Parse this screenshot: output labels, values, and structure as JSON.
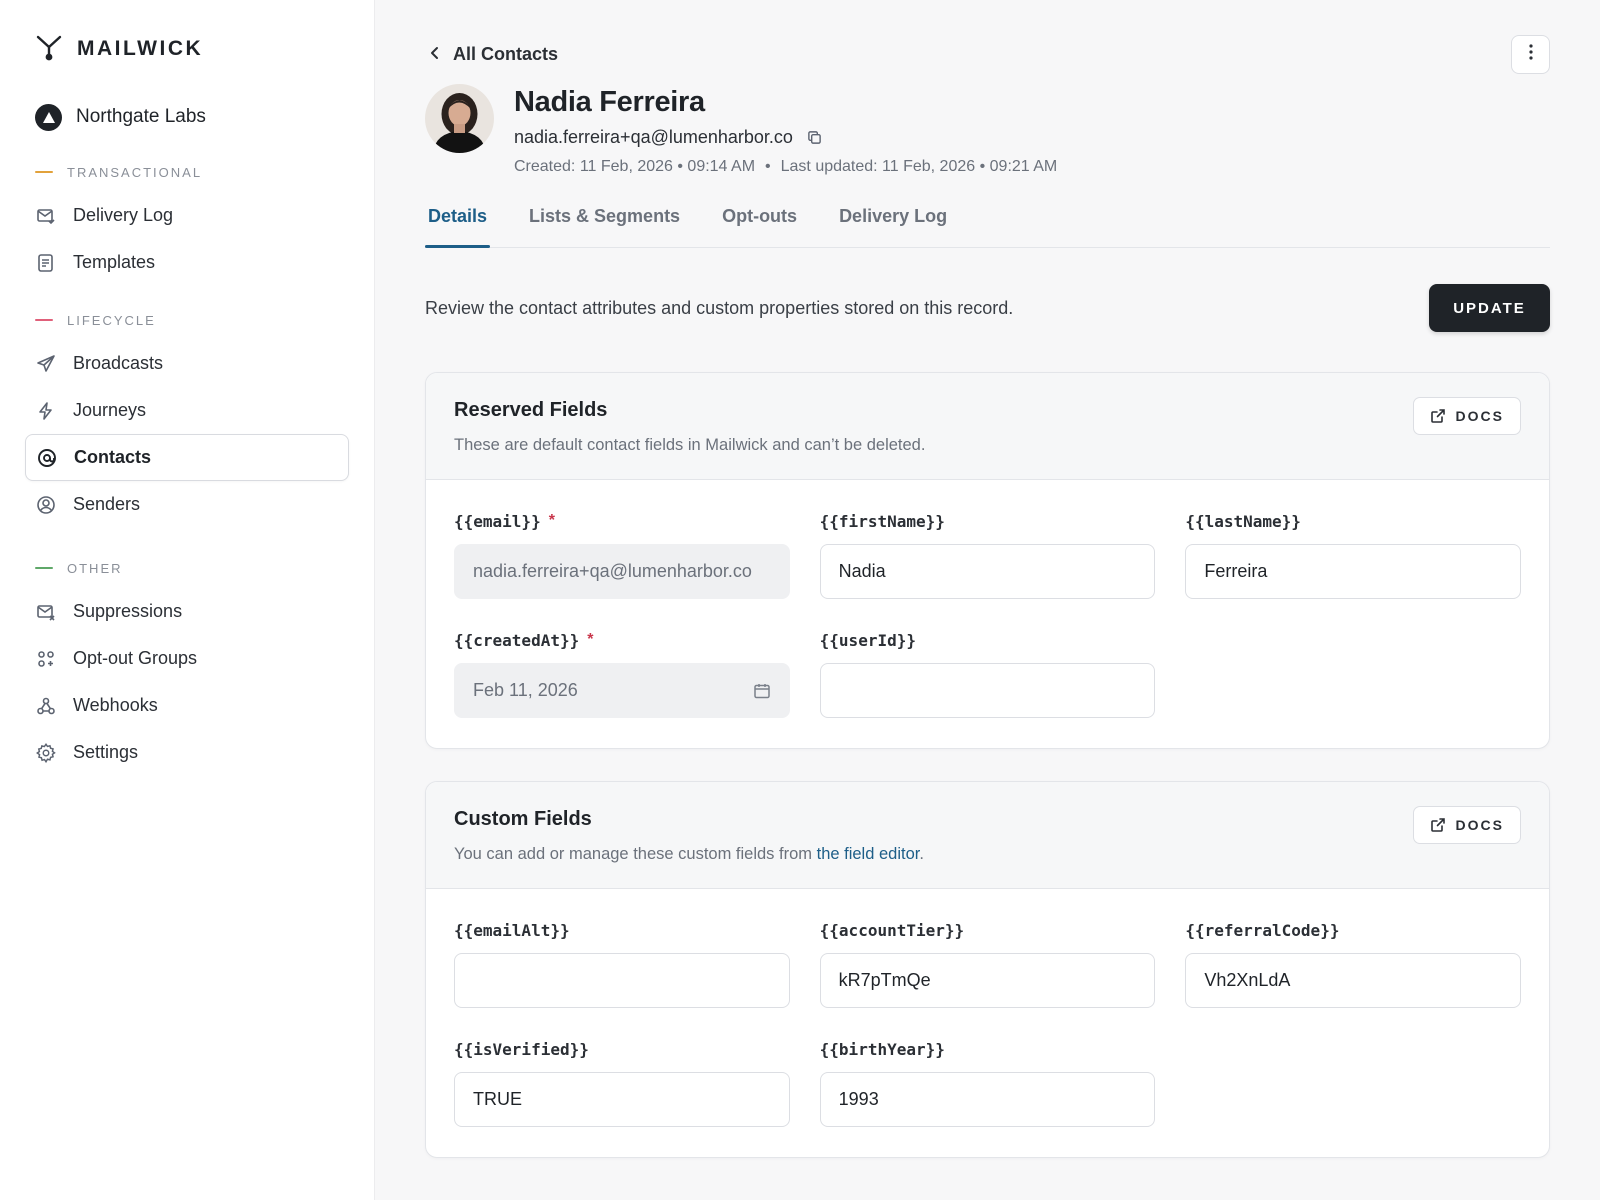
{
  "brand": {
    "name": "MAILWICK"
  },
  "org": {
    "name": "Northgate Labs"
  },
  "sidebar": {
    "sections": [
      {
        "label": "TRANSACTIONAL",
        "color": "#e2a23b",
        "items": [
          {
            "label": "Delivery Log",
            "icon": "mail-log-icon"
          },
          {
            "label": "Templates",
            "icon": "template-icon"
          }
        ]
      },
      {
        "label": "LIFECYCLE",
        "color": "#e0607a",
        "items": [
          {
            "label": "Broadcasts",
            "icon": "send-icon"
          },
          {
            "label": "Journeys",
            "icon": "bolt-icon"
          },
          {
            "label": "Contacts",
            "icon": "at-icon",
            "active": true
          },
          {
            "label": "Senders",
            "icon": "user-circle-icon"
          }
        ]
      },
      {
        "label": "OTHER",
        "color": "#5fa869",
        "items": [
          {
            "label": "Suppressions",
            "icon": "mail-block-icon"
          },
          {
            "label": "Opt-out Groups",
            "icon": "groups-icon"
          },
          {
            "label": "Webhooks",
            "icon": "webhook-icon"
          },
          {
            "label": "Settings",
            "icon": "gear-icon"
          }
        ]
      }
    ]
  },
  "header": {
    "back_label": "All Contacts"
  },
  "contact": {
    "name": "Nadia Ferreira",
    "email": "nadia.ferreira+qa@lumenharbor.co",
    "created": "Created: 11 Feb, 2026 • 09:14 AM",
    "sep": "•",
    "updated": "Last updated: 11 Feb, 2026 • 09:21 AM"
  },
  "tabs": [
    {
      "label": "Details",
      "active": true
    },
    {
      "label": "Lists & Segments"
    },
    {
      "label": "Opt-outs"
    },
    {
      "label": "Delivery Log"
    }
  ],
  "intro": {
    "text": "Review the contact attributes and custom properties stored on this record.",
    "update_label": "UPDATE"
  },
  "reserved": {
    "title": "Reserved Fields",
    "subtitle": "These are default contact fields in Mailwick and can’t be deleted.",
    "docs_label": "DOCS",
    "fields": [
      {
        "label": "{{email}}",
        "required": true,
        "value": "nadia.ferreira+qa@lumenharbor.co",
        "disabled": true
      },
      {
        "label": "{{firstName}}",
        "value": "Nadia"
      },
      {
        "label": "{{lastName}}",
        "value": "Ferreira"
      },
      {
        "label": "{{createdAt}}",
        "required": true,
        "value": "Feb 11, 2026",
        "disabled": true,
        "calendar": true
      },
      {
        "label": "{{userId}}",
        "value": ""
      }
    ]
  },
  "custom": {
    "title": "Custom Fields",
    "subtitle_prefix": "You can add or manage these custom fields from ",
    "subtitle_link": "the field editor",
    "subtitle_suffix": ".",
    "docs_label": "DOCS",
    "fields": [
      {
        "label": "{{emailAlt}}",
        "value": ""
      },
      {
        "label": "{{accountTier}}",
        "value": "kR7pTmQe"
      },
      {
        "label": "{{referralCode}}",
        "value": "Vh2XnLdA"
      },
      {
        "label": "{{isVerified}}",
        "value": "TRUE"
      },
      {
        "label": "{{birthYear}}",
        "value": "1993"
      }
    ]
  }
}
